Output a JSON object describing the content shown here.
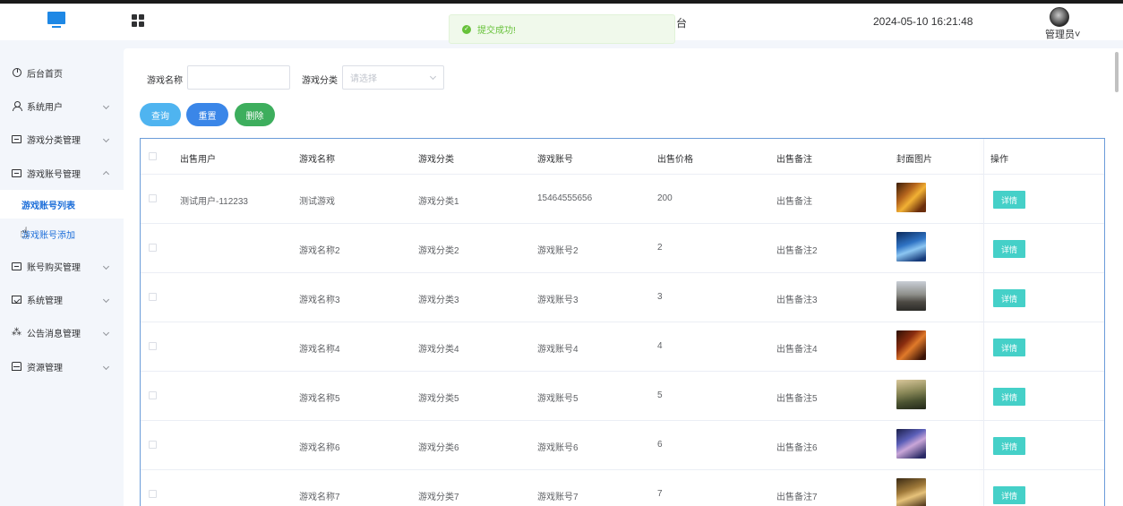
{
  "header": {
    "title_fragment": "台",
    "datetime": "2024-05-10 16:21:48",
    "user_label": "管理员",
    "user_caret": "˅"
  },
  "toast": {
    "icon": "check-circle-icon",
    "message": "提交成功!",
    "color": "#67c23a"
  },
  "sidebar": {
    "items": [
      {
        "label": "后台首页",
        "icon": "dashboard-icon"
      },
      {
        "label": "系统用户",
        "icon": "user-icon"
      },
      {
        "label": "游戏分类管理",
        "icon": "card-icon"
      },
      {
        "label": "游戏账号管理",
        "icon": "card-icon",
        "expanded": true
      },
      {
        "label": "账号购买管理",
        "icon": "card-icon"
      },
      {
        "label": "系统管理",
        "icon": "folder-icon"
      },
      {
        "label": "公告消息管理",
        "icon": "sparkle-icon"
      },
      {
        "label": "资源管理",
        "icon": "box-icon"
      }
    ],
    "subitems": [
      {
        "label": "游戏账号列表",
        "active": true
      },
      {
        "label": "游戏账号添加",
        "active": false
      }
    ]
  },
  "search": {
    "name_label": "游戏名称",
    "name_value": "",
    "category_label": "游戏分类",
    "category_placeholder": "请选择"
  },
  "buttons": {
    "query": "查询",
    "reset": "重置",
    "delete": "删除"
  },
  "table": {
    "headers": [
      "出售用户",
      "游戏名称",
      "游戏分类",
      "游戏账号",
      "出售价格",
      "出售备注",
      "封面图片",
      "操作"
    ],
    "detail_label": "详情",
    "rows": [
      {
        "seller": "测试用户-112233",
        "name": "测试游戏",
        "category": "游戏分类1",
        "account": "15464555656",
        "price": "200",
        "note": "出售备注"
      },
      {
        "seller": "",
        "name": "游戏名称2",
        "category": "游戏分类2",
        "account": "游戏账号2",
        "price": "2",
        "note": "出售备注2"
      },
      {
        "seller": "",
        "name": "游戏名称3",
        "category": "游戏分类3",
        "account": "游戏账号3",
        "price": "3",
        "note": "出售备注3"
      },
      {
        "seller": "",
        "name": "游戏名称4",
        "category": "游戏分类4",
        "account": "游戏账号4",
        "price": "4",
        "note": "出售备注4"
      },
      {
        "seller": "",
        "name": "游戏名称5",
        "category": "游戏分类5",
        "account": "游戏账号5",
        "price": "5",
        "note": "出售备注5"
      },
      {
        "seller": "",
        "name": "游戏名称6",
        "category": "游戏分类6",
        "account": "游戏账号6",
        "price": "6",
        "note": "出售备注6"
      },
      {
        "seller": "",
        "name": "游戏名称7",
        "category": "游戏分类7",
        "account": "游戏账号7",
        "price": "7",
        "note": "出售备注7"
      }
    ]
  },
  "colors": {
    "accent": "#1e6fd9",
    "detail_button": "#45d0c8",
    "query": "#4fb4f0",
    "reset": "#3a86e8",
    "delete": "#3dae5d"
  }
}
